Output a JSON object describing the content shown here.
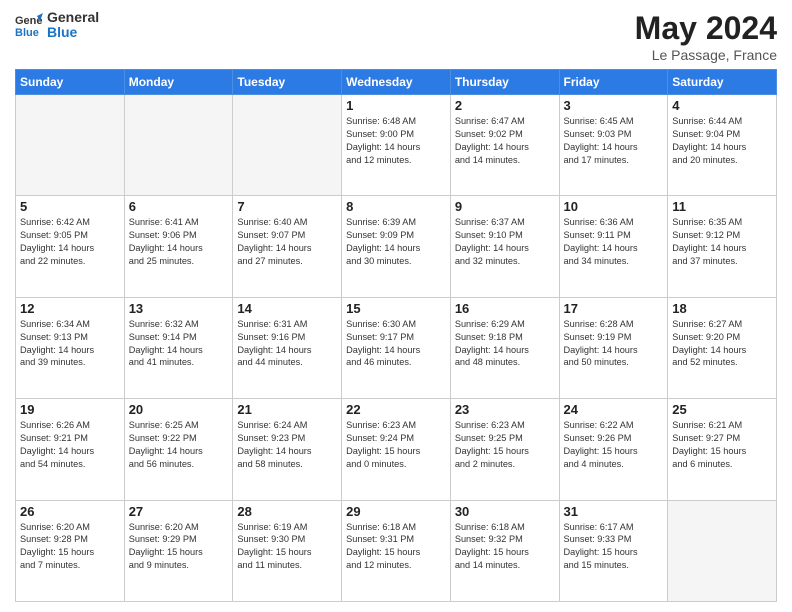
{
  "header": {
    "logo_line1": "General",
    "logo_line2": "Blue",
    "main_title": "May 2024",
    "subtitle": "Le Passage, France"
  },
  "weekdays": [
    "Sunday",
    "Monday",
    "Tuesday",
    "Wednesday",
    "Thursday",
    "Friday",
    "Saturday"
  ],
  "weeks": [
    [
      {
        "day": "",
        "lines": [],
        "empty": true
      },
      {
        "day": "",
        "lines": [],
        "empty": true
      },
      {
        "day": "",
        "lines": [],
        "empty": true
      },
      {
        "day": "1",
        "lines": [
          "Sunrise: 6:48 AM",
          "Sunset: 9:00 PM",
          "Daylight: 14 hours",
          "and 12 minutes."
        ],
        "empty": false
      },
      {
        "day": "2",
        "lines": [
          "Sunrise: 6:47 AM",
          "Sunset: 9:02 PM",
          "Daylight: 14 hours",
          "and 14 minutes."
        ],
        "empty": false
      },
      {
        "day": "3",
        "lines": [
          "Sunrise: 6:45 AM",
          "Sunset: 9:03 PM",
          "Daylight: 14 hours",
          "and 17 minutes."
        ],
        "empty": false
      },
      {
        "day": "4",
        "lines": [
          "Sunrise: 6:44 AM",
          "Sunset: 9:04 PM",
          "Daylight: 14 hours",
          "and 20 minutes."
        ],
        "empty": false
      }
    ],
    [
      {
        "day": "5",
        "lines": [
          "Sunrise: 6:42 AM",
          "Sunset: 9:05 PM",
          "Daylight: 14 hours",
          "and 22 minutes."
        ],
        "empty": false
      },
      {
        "day": "6",
        "lines": [
          "Sunrise: 6:41 AM",
          "Sunset: 9:06 PM",
          "Daylight: 14 hours",
          "and 25 minutes."
        ],
        "empty": false
      },
      {
        "day": "7",
        "lines": [
          "Sunrise: 6:40 AM",
          "Sunset: 9:07 PM",
          "Daylight: 14 hours",
          "and 27 minutes."
        ],
        "empty": false
      },
      {
        "day": "8",
        "lines": [
          "Sunrise: 6:39 AM",
          "Sunset: 9:09 PM",
          "Daylight: 14 hours",
          "and 30 minutes."
        ],
        "empty": false
      },
      {
        "day": "9",
        "lines": [
          "Sunrise: 6:37 AM",
          "Sunset: 9:10 PM",
          "Daylight: 14 hours",
          "and 32 minutes."
        ],
        "empty": false
      },
      {
        "day": "10",
        "lines": [
          "Sunrise: 6:36 AM",
          "Sunset: 9:11 PM",
          "Daylight: 14 hours",
          "and 34 minutes."
        ],
        "empty": false
      },
      {
        "day": "11",
        "lines": [
          "Sunrise: 6:35 AM",
          "Sunset: 9:12 PM",
          "Daylight: 14 hours",
          "and 37 minutes."
        ],
        "empty": false
      }
    ],
    [
      {
        "day": "12",
        "lines": [
          "Sunrise: 6:34 AM",
          "Sunset: 9:13 PM",
          "Daylight: 14 hours",
          "and 39 minutes."
        ],
        "empty": false
      },
      {
        "day": "13",
        "lines": [
          "Sunrise: 6:32 AM",
          "Sunset: 9:14 PM",
          "Daylight: 14 hours",
          "and 41 minutes."
        ],
        "empty": false
      },
      {
        "day": "14",
        "lines": [
          "Sunrise: 6:31 AM",
          "Sunset: 9:16 PM",
          "Daylight: 14 hours",
          "and 44 minutes."
        ],
        "empty": false
      },
      {
        "day": "15",
        "lines": [
          "Sunrise: 6:30 AM",
          "Sunset: 9:17 PM",
          "Daylight: 14 hours",
          "and 46 minutes."
        ],
        "empty": false
      },
      {
        "day": "16",
        "lines": [
          "Sunrise: 6:29 AM",
          "Sunset: 9:18 PM",
          "Daylight: 14 hours",
          "and 48 minutes."
        ],
        "empty": false
      },
      {
        "day": "17",
        "lines": [
          "Sunrise: 6:28 AM",
          "Sunset: 9:19 PM",
          "Daylight: 14 hours",
          "and 50 minutes."
        ],
        "empty": false
      },
      {
        "day": "18",
        "lines": [
          "Sunrise: 6:27 AM",
          "Sunset: 9:20 PM",
          "Daylight: 14 hours",
          "and 52 minutes."
        ],
        "empty": false
      }
    ],
    [
      {
        "day": "19",
        "lines": [
          "Sunrise: 6:26 AM",
          "Sunset: 9:21 PM",
          "Daylight: 14 hours",
          "and 54 minutes."
        ],
        "empty": false
      },
      {
        "day": "20",
        "lines": [
          "Sunrise: 6:25 AM",
          "Sunset: 9:22 PM",
          "Daylight: 14 hours",
          "and 56 minutes."
        ],
        "empty": false
      },
      {
        "day": "21",
        "lines": [
          "Sunrise: 6:24 AM",
          "Sunset: 9:23 PM",
          "Daylight: 14 hours",
          "and 58 minutes."
        ],
        "empty": false
      },
      {
        "day": "22",
        "lines": [
          "Sunrise: 6:23 AM",
          "Sunset: 9:24 PM",
          "Daylight: 15 hours",
          "and 0 minutes."
        ],
        "empty": false
      },
      {
        "day": "23",
        "lines": [
          "Sunrise: 6:23 AM",
          "Sunset: 9:25 PM",
          "Daylight: 15 hours",
          "and 2 minutes."
        ],
        "empty": false
      },
      {
        "day": "24",
        "lines": [
          "Sunrise: 6:22 AM",
          "Sunset: 9:26 PM",
          "Daylight: 15 hours",
          "and 4 minutes."
        ],
        "empty": false
      },
      {
        "day": "25",
        "lines": [
          "Sunrise: 6:21 AM",
          "Sunset: 9:27 PM",
          "Daylight: 15 hours",
          "and 6 minutes."
        ],
        "empty": false
      }
    ],
    [
      {
        "day": "26",
        "lines": [
          "Sunrise: 6:20 AM",
          "Sunset: 9:28 PM",
          "Daylight: 15 hours",
          "and 7 minutes."
        ],
        "empty": false
      },
      {
        "day": "27",
        "lines": [
          "Sunrise: 6:20 AM",
          "Sunset: 9:29 PM",
          "Daylight: 15 hours",
          "and 9 minutes."
        ],
        "empty": false
      },
      {
        "day": "28",
        "lines": [
          "Sunrise: 6:19 AM",
          "Sunset: 9:30 PM",
          "Daylight: 15 hours",
          "and 11 minutes."
        ],
        "empty": false
      },
      {
        "day": "29",
        "lines": [
          "Sunrise: 6:18 AM",
          "Sunset: 9:31 PM",
          "Daylight: 15 hours",
          "and 12 minutes."
        ],
        "empty": false
      },
      {
        "day": "30",
        "lines": [
          "Sunrise: 6:18 AM",
          "Sunset: 9:32 PM",
          "Daylight: 15 hours",
          "and 14 minutes."
        ],
        "empty": false
      },
      {
        "day": "31",
        "lines": [
          "Sunrise: 6:17 AM",
          "Sunset: 9:33 PM",
          "Daylight: 15 hours",
          "and 15 minutes."
        ],
        "empty": false
      },
      {
        "day": "",
        "lines": [],
        "empty": true
      }
    ]
  ]
}
